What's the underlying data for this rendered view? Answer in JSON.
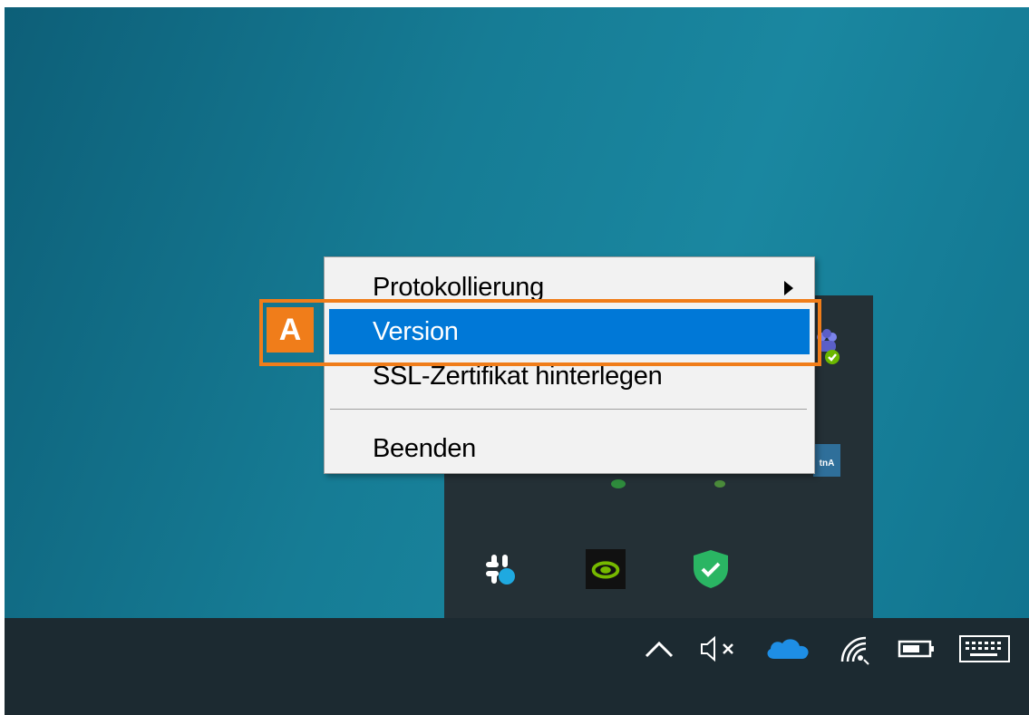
{
  "context_menu": {
    "items": [
      {
        "label": "Protokollierung",
        "has_submenu": true
      },
      {
        "label": "Version",
        "highlighted": true
      },
      {
        "label": "SSL-Zertifikat hinterlegen"
      },
      {
        "label": "Beenden"
      }
    ]
  },
  "annotation": {
    "badge": "A",
    "color": "#f07d1a"
  },
  "tray_overflow": {
    "icons": [
      "slack-icon",
      "nvidia-icon",
      "security-shield-icon",
      "teams-icon",
      "app-icon",
      "green-icon"
    ]
  },
  "taskbar": {
    "icons": [
      "chevron-up-icon",
      "speaker-muted-icon",
      "onedrive-icon",
      "wifi-icon",
      "battery-icon",
      "keyboard-icon"
    ]
  },
  "colors": {
    "menu_highlight": "#0078d7",
    "taskbar": "#1c2a31",
    "tray_panel": "#243036"
  }
}
